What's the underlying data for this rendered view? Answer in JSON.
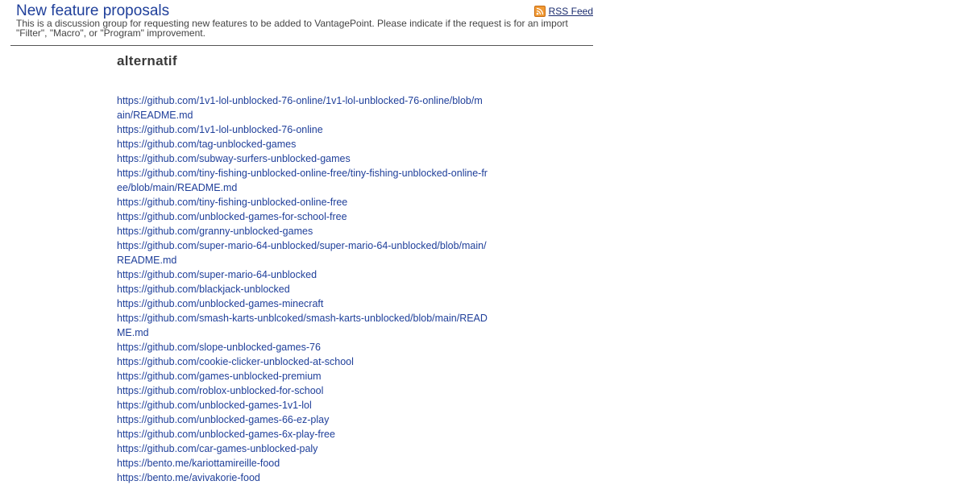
{
  "header": {
    "title": "New feature proposals",
    "description": "This is a discussion group for requesting new features to be added to VantagePoint. Please indicate if the request is for an import \"Filter\", \"Macro\", or \"Program\" improvement.",
    "rss_label": "RSS Feed",
    "rss_icon": "rss-icon"
  },
  "post": {
    "title": "alternatif",
    "links": [
      "https://github.com/1v1-lol-unblocked-76-online/1v1-lol-unblocked-76-online/blob/main/README.md",
      "https://github.com/1v1-lol-unblocked-76-online",
      "https://github.com/tag-unblocked-games",
      "https://github.com/subway-surfers-unblocked-games",
      "https://github.com/tiny-fishing-unblocked-online-free/tiny-fishing-unblocked-online-free/blob/main/README.md",
      "https://github.com/tiny-fishing-unblocked-online-free",
      "https://github.com/unblocked-games-for-school-free",
      "https://github.com/granny-unblocked-games",
      "https://github.com/super-mario-64-unblocked/super-mario-64-unblocked/blob/main/README.md",
      "https://github.com/super-mario-64-unblocked",
      "https://github.com/blackjack-unblocked",
      "https://github.com/unblocked-games-minecraft",
      "https://github.com/smash-karts-unblcoked/smash-karts-unblocked/blob/main/README.md",
      "https://github.com/slope-unblocked-games-76",
      "https://github.com/cookie-clicker-unblocked-at-school",
      "https://github.com/games-unblocked-premium",
      "https://github.com/roblox-unblocked-for-school",
      "https://github.com/unblocked-games-1v1-lol",
      "https://github.com/unblocked-games-66-ez-play",
      "https://github.com/unblocked-games-6x-play-free",
      "https://github.com/car-games-unblocked-paly",
      "https://bento.me/kariottamireille-food",
      "https://bento.me/avivakorie-food"
    ]
  },
  "colors": {
    "title_link": "#1f3f9a",
    "rss_orange": "#f19a35",
    "divider": "#555555"
  }
}
